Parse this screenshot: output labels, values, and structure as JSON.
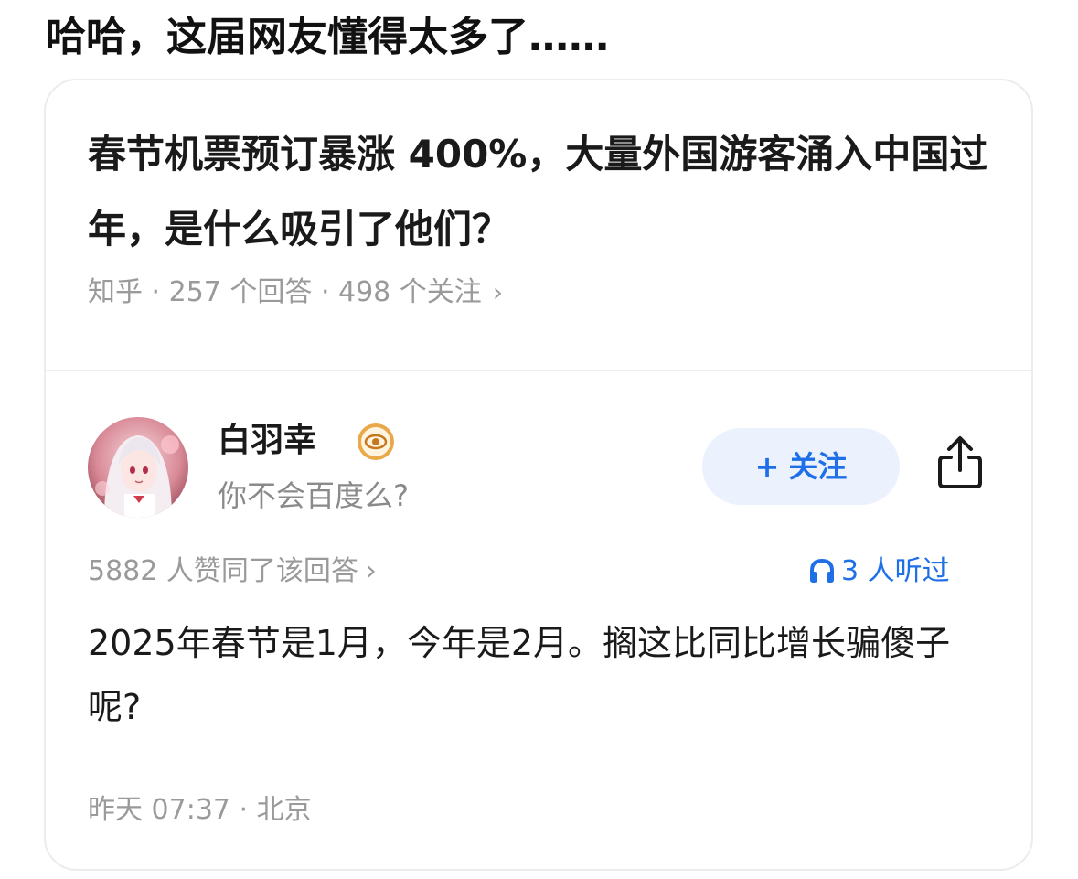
{
  "caption": "哈哈，这届网友懂得太多了……",
  "question": {
    "title": "春节机票预订暴涨 400%，大量外国游客涌入中国过年，是什么吸引了他们？",
    "meta": "知乎 · 257 个回答 · 498 个关注",
    "meta_chevron": "›"
  },
  "answer": {
    "author": {
      "name": "白羽幸",
      "bio": "你不会百度么?",
      "avatar_icon": "anime-avatar",
      "badge_icon": "verified-badge-icon"
    },
    "follow_button": {
      "plus": "+",
      "label": "关注"
    },
    "share_icon": "share-icon",
    "likes": "5882 人赞同了该回答",
    "likes_chevron": "›",
    "listened": "3 人听过",
    "listened_icon": "headphones-icon",
    "text": "2025年春节是1月，今年是2月。搁这比同比增长骗傻子呢?",
    "time_location": "昨天 07:37 · 北京"
  },
  "colors": {
    "accent": "#1f6fe8",
    "follow_bg": "#ebf2fd",
    "meta_text": "#9a9a9a",
    "title_text": "#1a1a1a"
  }
}
